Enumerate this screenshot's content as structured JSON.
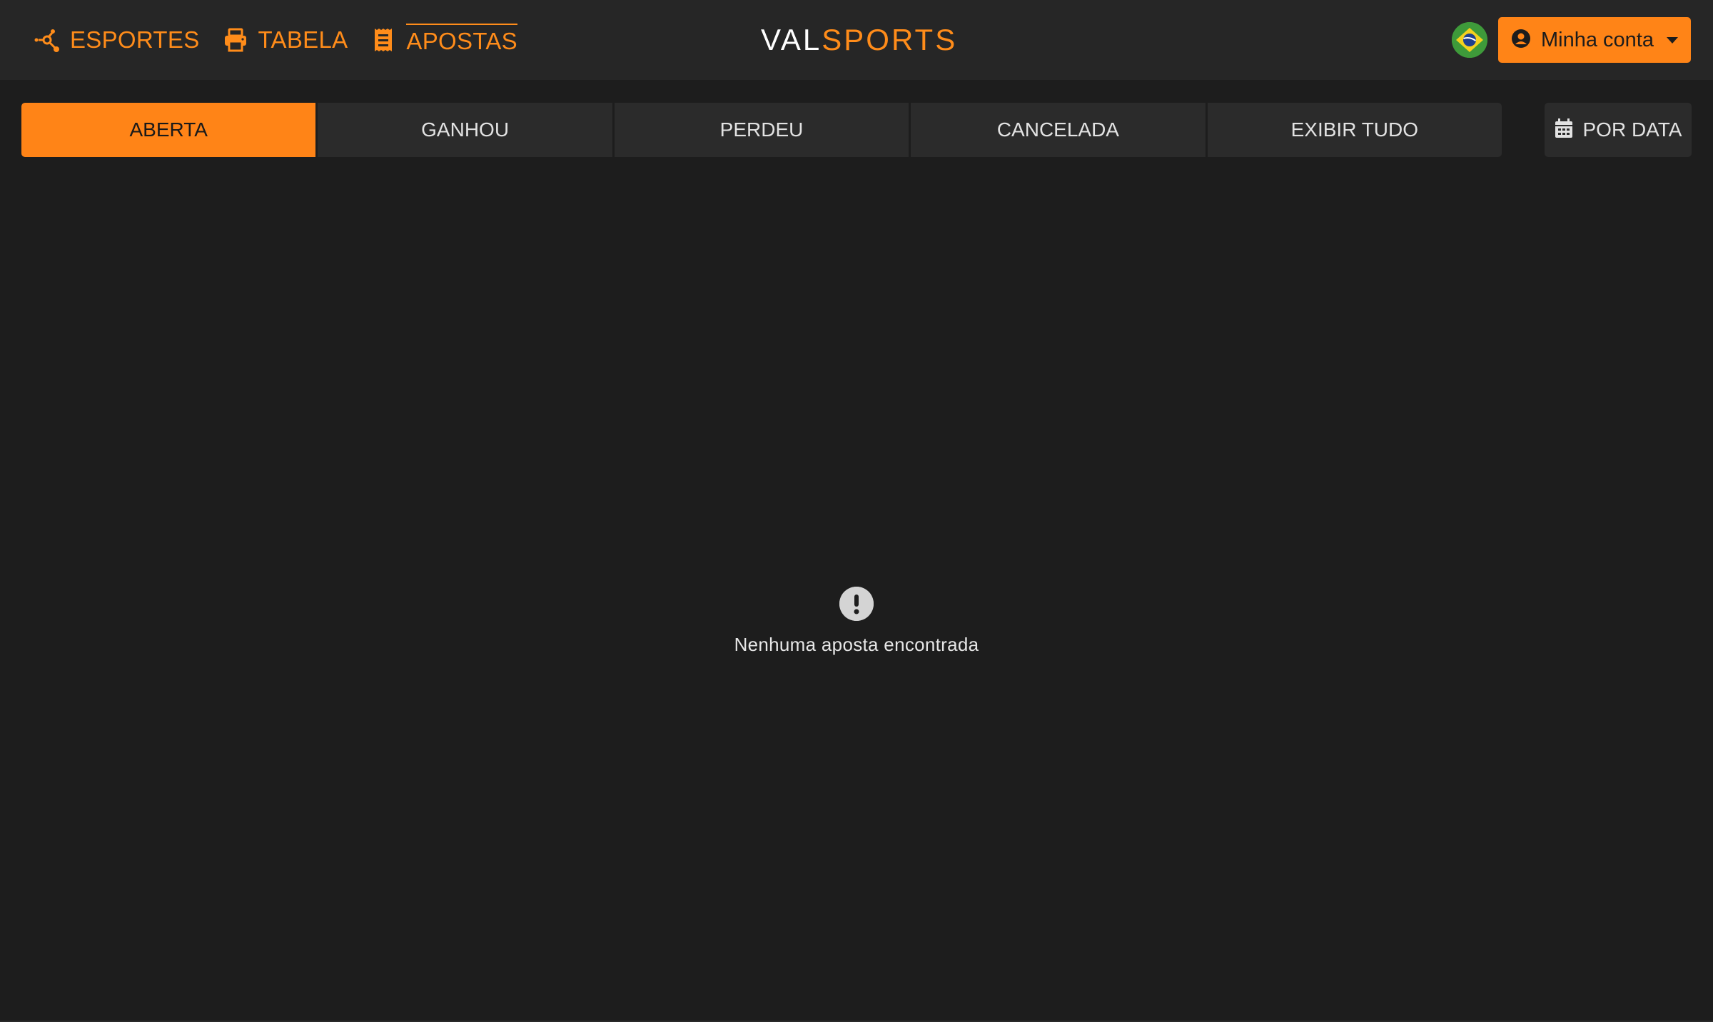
{
  "header": {
    "nav": [
      {
        "label": "ESPORTES",
        "icon": "sports-network-icon"
      },
      {
        "label": "TABELA",
        "icon": "printer-icon"
      },
      {
        "label": "APOSTAS",
        "icon": "receipt-icon"
      }
    ],
    "logo": {
      "part1": "VAL",
      "part2": "SPORTS"
    },
    "language_flag": "brazil-flag-icon",
    "account_button": {
      "label": "Minha conta",
      "icon": "user-circle-icon"
    }
  },
  "filters": {
    "tabs": [
      {
        "label": "ABERTA",
        "active": true
      },
      {
        "label": "GANHOU",
        "active": false
      },
      {
        "label": "PERDEU",
        "active": false
      },
      {
        "label": "CANCELADA",
        "active": false
      },
      {
        "label": "EXIBIR TUDO",
        "active": false
      }
    ],
    "date_button": {
      "label": "POR DATA",
      "icon": "calendar-icon"
    }
  },
  "empty_state": {
    "icon": "exclamation-circle-icon",
    "message": "Nenhuma aposta encontrada"
  },
  "colors": {
    "accent": "#ff8417",
    "background": "#1d1d1d",
    "topbar": "#262626",
    "tab_background": "#2b2b2b"
  }
}
